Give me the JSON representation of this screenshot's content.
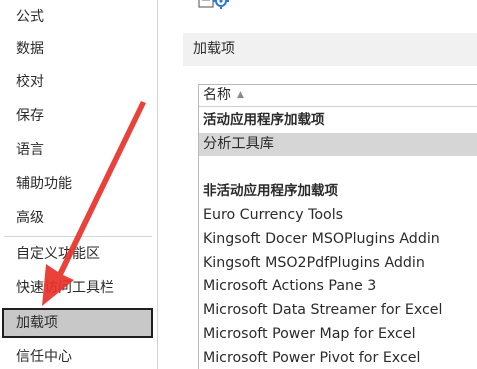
{
  "nav": {
    "items": [
      {
        "label": "公式"
      },
      {
        "label": "数据"
      },
      {
        "label": "校对"
      },
      {
        "label": "保存"
      },
      {
        "label": "语言"
      },
      {
        "label": "辅助功能"
      },
      {
        "label": "高级"
      },
      {
        "label": "自定义功能区"
      },
      {
        "label": "快速访问工具栏"
      },
      {
        "label": "加载项"
      },
      {
        "label": "信任中心"
      }
    ],
    "selected_label": "加载项"
  },
  "content": {
    "section_title": "加载项",
    "list": {
      "column_header": "名称",
      "rows": [
        {
          "text": "活动应用程序加载项",
          "kind": "group"
        },
        {
          "text": "分析工具库",
          "kind": "item-highlight"
        },
        {
          "text": "",
          "kind": "spacer"
        },
        {
          "text": "非活动应用程序加载项",
          "kind": "group"
        },
        {
          "text": "Euro Currency Tools",
          "kind": "item"
        },
        {
          "text": "Kingsoft Docer MSOPlugins Addin",
          "kind": "item"
        },
        {
          "text": "Kingsoft MSO2PdfPlugins Addin",
          "kind": "item"
        },
        {
          "text": "Microsoft Actions Pane 3",
          "kind": "item"
        },
        {
          "text": "Microsoft Data Streamer for Excel",
          "kind": "item"
        },
        {
          "text": "Microsoft Power Map for Excel",
          "kind": "item"
        },
        {
          "text": "Microsoft Power Pivot for Excel",
          "kind": "item"
        }
      ]
    }
  },
  "icons": {
    "settings": "gear-icon",
    "sort": "sort-ascending-icon",
    "annotation": "red-arrow-icon"
  },
  "colors": {
    "accent_arrow": "#e8312a",
    "selected_bg": "#c8c8c8",
    "highlight_row": "#d6d6d6",
    "section_band": "#f1f1f1",
    "icon_blue": "#2e75d8"
  }
}
